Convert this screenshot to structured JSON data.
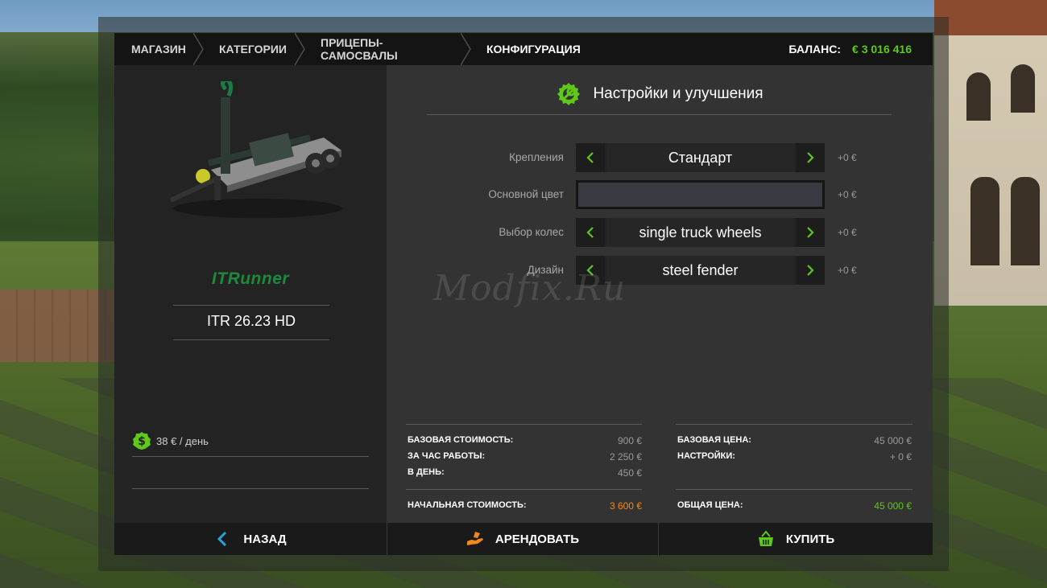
{
  "breadcrumb": {
    "items": [
      "МАГАЗИН",
      "КАТЕГОРИИ",
      "ПРИЦЕПЫ-САМОСВАЛЫ",
      "КОНФИГУРАЦИЯ"
    ]
  },
  "balance": {
    "label": "БАЛАНС:",
    "value": "€ 3 016 416"
  },
  "product": {
    "brand": "ITRunner",
    "model": "ITR 26.23 HD",
    "daily_cost": "38 € / день"
  },
  "config": {
    "title": "Настройки и улучшения",
    "rows": [
      {
        "label": "Крепления",
        "value": "Стандарт",
        "price": "+0 €"
      },
      {
        "label": "Основной цвет",
        "value": "",
        "price": "+0 €"
      },
      {
        "label": "Выбор колес",
        "value": "single truck wheels",
        "price": "+0 €"
      },
      {
        "label": "Дизайн",
        "value": "steel fender",
        "price": "+0 €"
      }
    ],
    "swatch_color": "#3a3a42"
  },
  "watermark": "Modfix.Ru",
  "costs": {
    "left": [
      {
        "k": "БАЗОВАЯ СТОИМОСТЬ:",
        "v": "900 €"
      },
      {
        "k": "ЗА ЧАС РАБОТЫ:",
        "v": "2 250 €"
      },
      {
        "k": "В ДЕНЬ:",
        "v": "450 €"
      }
    ],
    "left_total": {
      "k": "НАЧАЛЬНАЯ СТОИМОСТЬ:",
      "v": "3 600 €"
    },
    "right": [
      {
        "k": "БАЗОВАЯ ЦЕНА:",
        "v": "45 000 €"
      },
      {
        "k": "НАСТРОЙКИ:",
        "v": "+ 0 €"
      }
    ],
    "right_total": {
      "k": "ОБЩАЯ ЦЕНА:",
      "v": "45 000 €"
    }
  },
  "actions": {
    "back": "НАЗАД",
    "rent": "АРЕНДОВАТЬ",
    "buy": "КУПИТЬ"
  },
  "colors": {
    "accent_green": "#5fc818",
    "accent_orange": "#f08a1c",
    "brand_green": "#1b8a3a"
  },
  "icons": {
    "settings": "gear-wrench-icon",
    "money": "dollar-coin-icon",
    "back": "chevron-left-icon",
    "rent": "hand-money-icon",
    "buy": "basket-icon"
  }
}
